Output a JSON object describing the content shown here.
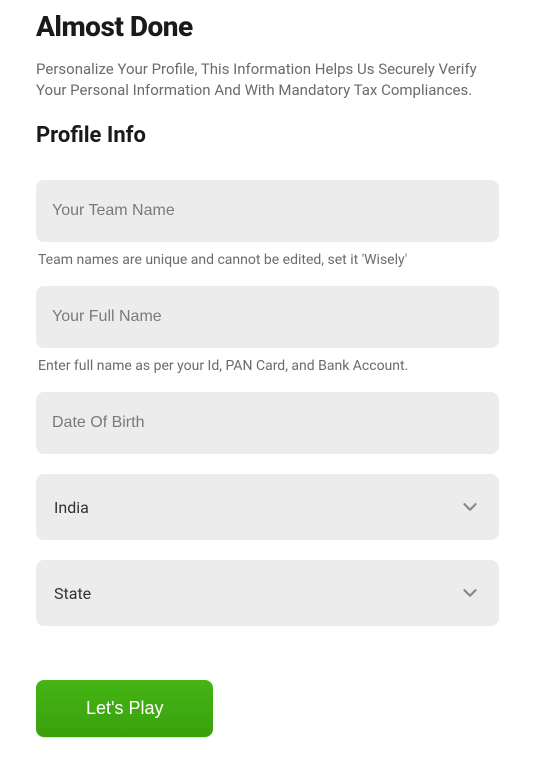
{
  "header": {
    "title": "Almost Done",
    "subtitle": "Personalize Your Profile, This Information Helps Us Securely Verify Your Personal Information And With Mandatory Tax Compliances."
  },
  "section": {
    "title": "Profile Info"
  },
  "form": {
    "teamName": {
      "placeholder": "Your Team Name",
      "value": "",
      "helper": "Team names are unique and cannot be edited, set it 'Wisely'"
    },
    "fullName": {
      "placeholder": "Your Full Name",
      "value": "",
      "helper": "Enter full name as per your Id, PAN Card, and Bank Account."
    },
    "dob": {
      "placeholder": "Date Of Birth",
      "value": ""
    },
    "country": {
      "selected": "India"
    },
    "state": {
      "selected": "State"
    }
  },
  "actions": {
    "submitLabel": "Let's Play"
  }
}
